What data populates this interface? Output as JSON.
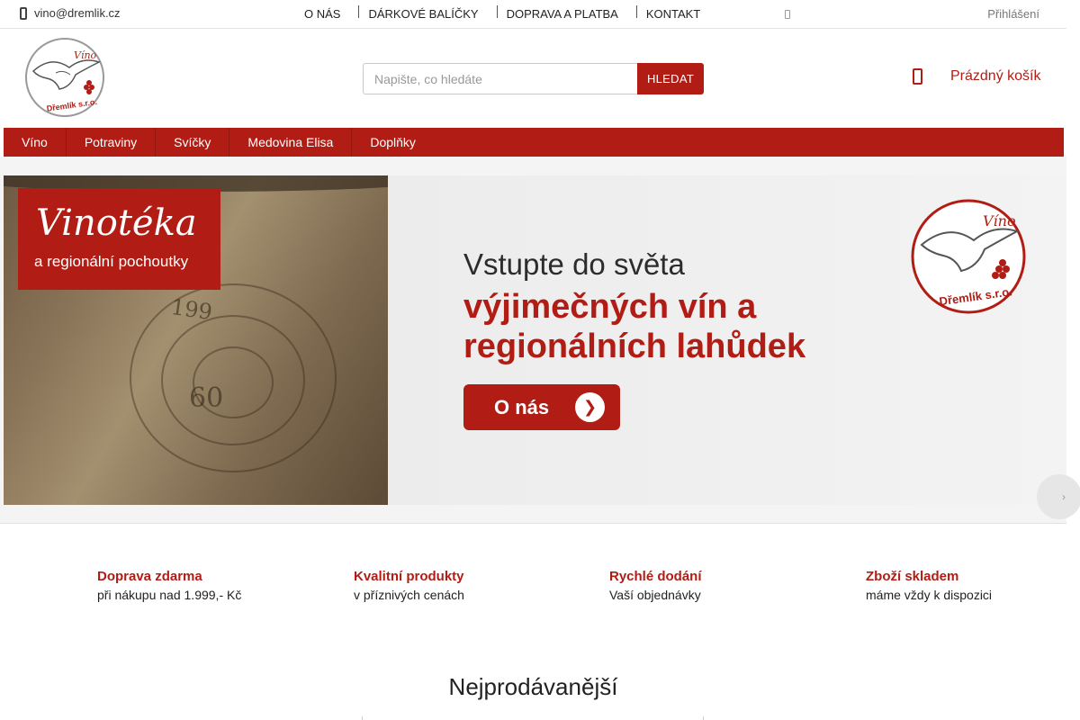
{
  "topbar": {
    "email": "vino@dremlik.cz",
    "nav": [
      "O NÁS",
      "DÁRKOVÉ BALÍČKY",
      "DOPRAVA A PLATBA",
      "KONTAKT"
    ],
    "login": "Přihlášení"
  },
  "search": {
    "placeholder": "Napište, co hledáte",
    "button": "HLEDAT"
  },
  "cart": {
    "label": "Prázdný košík"
  },
  "categories": [
    "Víno",
    "Potraviny",
    "Svíčky",
    "Medovina Elisa",
    "Doplňky"
  ],
  "banner": {
    "badge_title": "Vinotéka",
    "badge_subtitle": "a regionální pochoutky",
    "headline_line1": "Vstupte do světa",
    "headline_line2": "výjimečných vín a regionálních lahůdek",
    "cta": "O nás",
    "barrel_text_1": "199",
    "barrel_text_2": "60"
  },
  "logo": {
    "top": "Víno",
    "bottom": "Dřemlík s.r.o."
  },
  "benefits": [
    {
      "title": "Doprava zdarma",
      "desc": "při nákupu nad 1.999,- Kč"
    },
    {
      "title": "Kvalitní produkty",
      "desc": "v příznivých cenách"
    },
    {
      "title": "Rychlé dodání",
      "desc": "Vaší objednávky"
    },
    {
      "title": "Zboží skladem",
      "desc": "máme vždy k dispozici"
    }
  ],
  "section_title": "Nejprodávanější",
  "colors": {
    "accent": "#b11d14"
  },
  "icons": [
    "phone-icon",
    "lock-icon",
    "cart-icon",
    "eagle-logo",
    "arrow-right-icon",
    "slider-next-icon"
  ]
}
